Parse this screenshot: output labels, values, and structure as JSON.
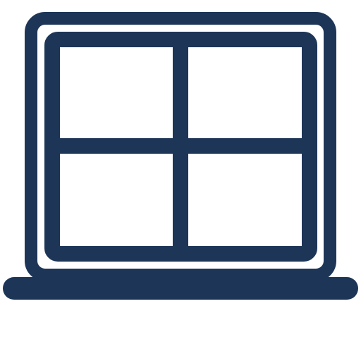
{
  "icon": {
    "name": "laptop-window-icon",
    "color": "#1d3557"
  }
}
